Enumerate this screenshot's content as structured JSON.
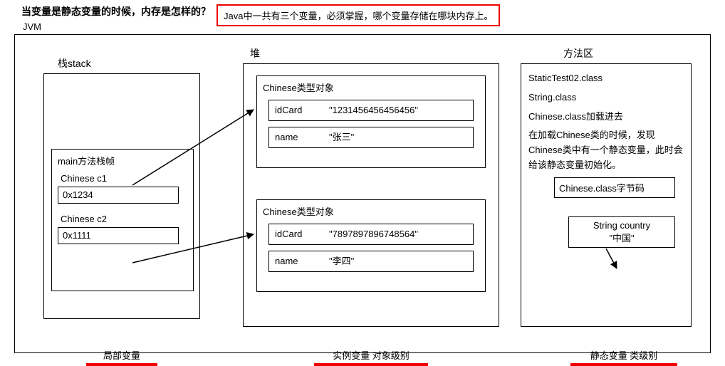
{
  "title_question": "当变量是静态变量的时候，内存是怎样的？",
  "callout_text": "Java中一共有三个变量，必须掌握，哪个变量存储在哪块内存上。",
  "jvm_label": "JVM",
  "stack": {
    "label": "栈stack",
    "frame": {
      "title": "main方法栈帧",
      "vars": [
        {
          "name": "Chinese c1",
          "addr": "0x1234"
        },
        {
          "name": "Chinese c2",
          "addr": "0x1111"
        }
      ]
    }
  },
  "heap": {
    "label": "堆",
    "objects": [
      {
        "title": "Chinese类型对象",
        "fields": [
          {
            "name": "idCard",
            "value": "\"1231456456456456\""
          },
          {
            "name": "name",
            "value": "\"张三\""
          }
        ]
      },
      {
        "title": "Chinese类型对象",
        "fields": [
          {
            "name": "idCard",
            "value": "\"7897897896748564\""
          },
          {
            "name": "name",
            "value": "\"李四\""
          }
        ]
      }
    ]
  },
  "method_area": {
    "label": "方法区",
    "lines": [
      "StaticTest02.class",
      "String.class",
      "Chinese.class加载进去",
      "在加载Chinese类的时候，发现Chinese类中有一个静态变量，此时会给该静态变量初始化。"
    ],
    "bytecode_label": "Chinese.class字节码",
    "static_var": {
      "decl": "String country",
      "value": "\"中国\""
    }
  },
  "footer": {
    "stack": "局部变量",
    "heap": "实例变量   对象级别",
    "method": "静态变量   类级别"
  }
}
